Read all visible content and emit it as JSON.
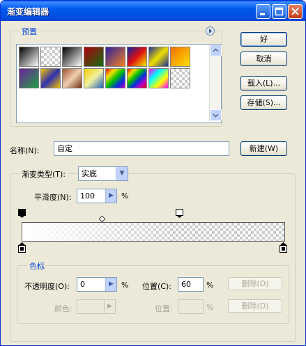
{
  "window": {
    "title": "渐变编辑器",
    "controls": {
      "minimize": "_",
      "maximize": "□",
      "close": "✕"
    }
  },
  "presets": {
    "legend": "预置",
    "menu_icon": "right-arrow-circle-icon",
    "swatches": [
      {
        "style": "linear-gradient(135deg,#000,#fff)"
      },
      {
        "style": "checker-fade"
      },
      {
        "style": "linear-gradient(135deg,#000,#fff)"
      },
      {
        "style": "linear-gradient(135deg,#b00010,#107010)"
      },
      {
        "style": "linear-gradient(135deg,#3020a0,#f08020)"
      },
      {
        "style": "linear-gradient(135deg,#1020a0,#e01010,#f0f000)"
      },
      {
        "style": "linear-gradient(135deg,#203090,#f0e000,#203090)"
      },
      {
        "style": "linear-gradient(135deg,#f07000,#ffe000)"
      },
      {
        "style": "linear-gradient(135deg,#7020a0,#20a040)"
      },
      {
        "style": "linear-gradient(135deg,#f0c000,#3030b0,#f0c000)"
      },
      {
        "style": "linear-gradient(135deg,#a05030,#f0d0b0,#703010)"
      },
      {
        "style": "linear-gradient(135deg,#f0d000,#f0f0a0,#2060c0)"
      },
      {
        "style": "linear-gradient(135deg,#e00000,#f0e000,#00c000,#0030e0,#c000c0)"
      },
      {
        "style": "linear-gradient(135deg,#e00000,#f0e000,#00c000,#0030e0,#c000c0,#e00000)"
      },
      {
        "style": "linear-gradient(135deg,#ff00ff,#00ffff,#ffff00,#ff00ff)"
      },
      {
        "style": "checker"
      }
    ]
  },
  "buttons": {
    "ok": "好",
    "cancel": "取消",
    "load": "载入(L)...",
    "save": "存储(S)...",
    "new": "新建(W)",
    "delete_opacity": "删除(D)",
    "delete_color": "删除(D)"
  },
  "name": {
    "label": "名称(N):",
    "value": "自定"
  },
  "gradient": {
    "type_label": "渐变类型(T):",
    "type_value": "实底",
    "smoothness_label": "平滑度(N):",
    "smoothness_value": "100",
    "smoothness_unit": "%"
  },
  "stops": {
    "legend": "色标",
    "opacity_label": "不透明度(O):",
    "opacity_value": "0",
    "opacity_unit": "%",
    "location_label": "位置(C):",
    "location_value": "60",
    "location_unit": "%",
    "color_label": "颜色:",
    "color_location_label": "位置:",
    "color_location_unit": "%"
  },
  "colors": {
    "title_bar": "#0058ee",
    "dialog_bg": "#ece9d8",
    "accent_text": "#0046d5"
  }
}
